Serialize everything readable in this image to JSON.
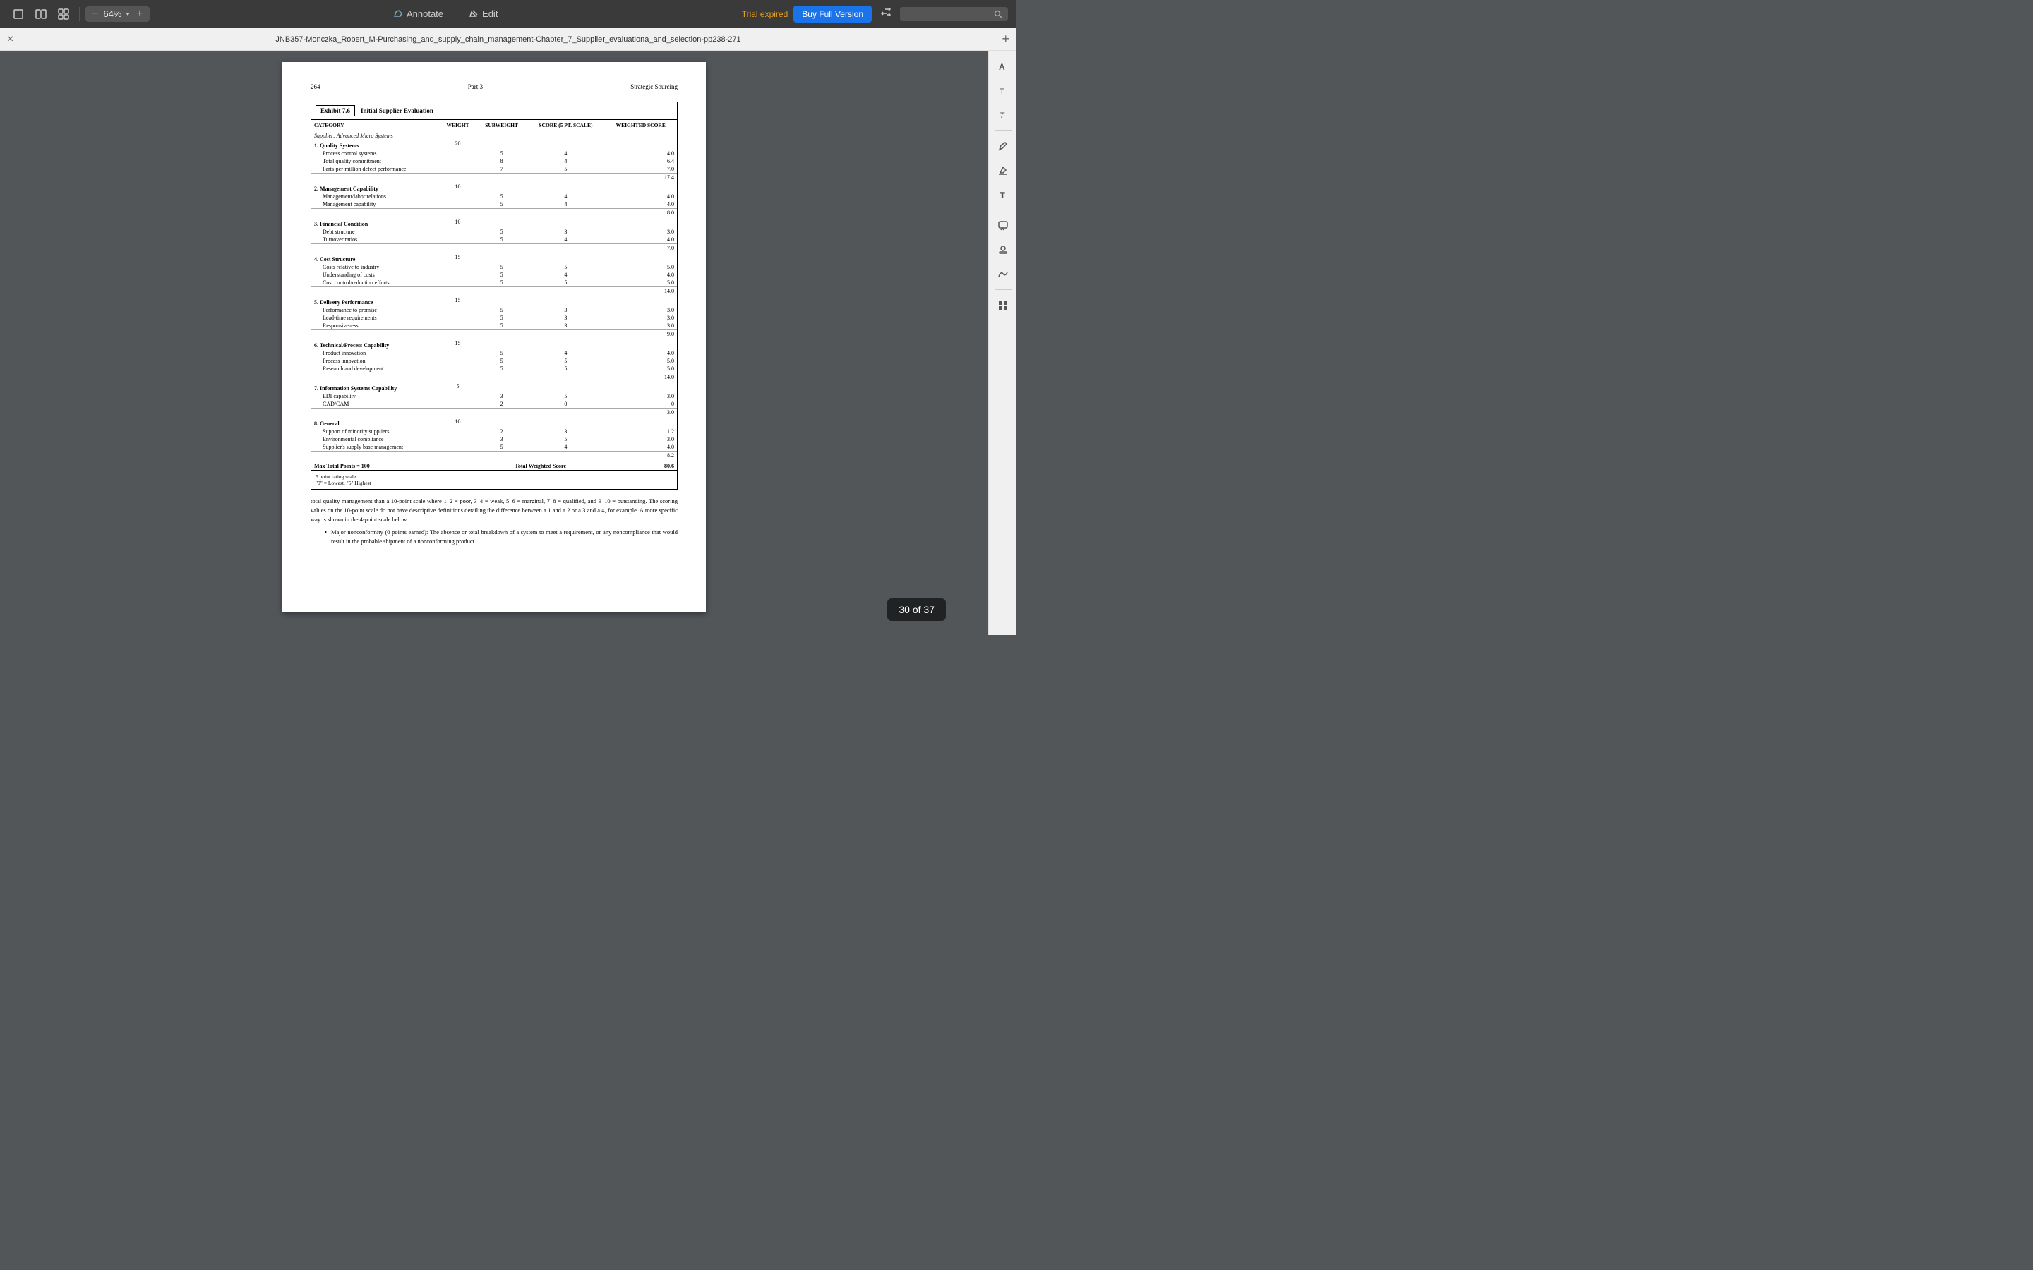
{
  "toolbar": {
    "zoom_value": "64%",
    "annotate_label": "Annotate",
    "edit_label": "Edit",
    "trial_label": "Trial expired",
    "buy_label": "Buy Full Version",
    "search_placeholder": ""
  },
  "titlebar": {
    "title": "JNB357-Monczka_Robert_M-Purchasing_and_supply_chain_management-Chapter_7_Supplier_evaluationa_and_selection-pp238-271",
    "close_icon": "×",
    "add_icon": "+"
  },
  "page": {
    "header_page": "264",
    "header_part": "Part 3",
    "header_title": "Strategic Sourcing",
    "exhibit_label": "Exhibit 7.6",
    "exhibit_title": "Initial Supplier Evaluation",
    "table": {
      "columns": [
        "CATEGORY",
        "WEIGHT",
        "SUBWEIGHT",
        "SCORE (5 PT. SCALE)",
        "WEIGHTED SCORE"
      ],
      "rows": [
        {
          "type": "supplier",
          "category": "Supplier: Advanced Micro Systems",
          "weight": "",
          "subweight": "",
          "score": "",
          "weighted": ""
        },
        {
          "type": "category",
          "category": "1. Quality Systems",
          "weight": "20",
          "subweight": "",
          "score": "",
          "weighted": ""
        },
        {
          "type": "sub",
          "category": "Process control systems",
          "weight": "",
          "subweight": "5",
          "score": "4",
          "weighted": "4.0"
        },
        {
          "type": "sub",
          "category": "Total quality commitment",
          "weight": "",
          "subweight": "8",
          "score": "4",
          "weighted": "6.4"
        },
        {
          "type": "sub",
          "category": "Parts-per-million defect performance",
          "weight": "",
          "subweight": "7",
          "score": "5",
          "weighted": "7.0"
        },
        {
          "type": "subtotal",
          "weighted": "17.4"
        },
        {
          "type": "category",
          "category": "2. Management Capability",
          "weight": "10",
          "subweight": "",
          "score": "",
          "weighted": ""
        },
        {
          "type": "sub",
          "category": "Management/labor relations",
          "weight": "",
          "subweight": "5",
          "score": "4",
          "weighted": "4.0"
        },
        {
          "type": "sub",
          "category": "Management capability",
          "weight": "",
          "subweight": "5",
          "score": "4",
          "weighted": "4.0"
        },
        {
          "type": "subtotal",
          "weighted": "8.0"
        },
        {
          "type": "category",
          "category": "3. Financial Condition",
          "weight": "10",
          "subweight": "",
          "score": "",
          "weighted": ""
        },
        {
          "type": "sub",
          "category": "Debt structure",
          "weight": "",
          "subweight": "5",
          "score": "3",
          "weighted": "3.0"
        },
        {
          "type": "sub",
          "category": "Turnover ratios",
          "weight": "",
          "subweight": "5",
          "score": "4",
          "weighted": "4.0"
        },
        {
          "type": "subtotal",
          "weighted": "7.0"
        },
        {
          "type": "category",
          "category": "4. Cost Structure",
          "weight": "15",
          "subweight": "",
          "score": "",
          "weighted": ""
        },
        {
          "type": "sub",
          "category": "Costs relative to industry",
          "weight": "",
          "subweight": "5",
          "score": "5",
          "weighted": "5.0"
        },
        {
          "type": "sub",
          "category": "Understanding of costs",
          "weight": "",
          "subweight": "5",
          "score": "4",
          "weighted": "4.0"
        },
        {
          "type": "sub",
          "category": "Cost control/reduction efforts",
          "weight": "",
          "subweight": "5",
          "score": "5",
          "weighted": "5.0"
        },
        {
          "type": "subtotal",
          "weighted": "14.0"
        },
        {
          "type": "category",
          "category": "5. Delivery Performance",
          "weight": "15",
          "subweight": "",
          "score": "",
          "weighted": ""
        },
        {
          "type": "sub",
          "category": "Performance to promise",
          "weight": "",
          "subweight": "5",
          "score": "3",
          "weighted": "3.0"
        },
        {
          "type": "sub",
          "category": "Lead-time requirements",
          "weight": "",
          "subweight": "5",
          "score": "3",
          "weighted": "3.0"
        },
        {
          "type": "sub",
          "category": "Responsiveness",
          "weight": "",
          "subweight": "5",
          "score": "3",
          "weighted": "3.0"
        },
        {
          "type": "subtotal",
          "weighted": "9.0"
        },
        {
          "type": "category",
          "category": "6. Technical/Process Capability",
          "weight": "15",
          "subweight": "",
          "score": "",
          "weighted": ""
        },
        {
          "type": "sub",
          "category": "Product innovation",
          "weight": "",
          "subweight": "5",
          "score": "4",
          "weighted": "4.0"
        },
        {
          "type": "sub",
          "category": "Process innovation",
          "weight": "",
          "subweight": "5",
          "score": "5",
          "weighted": "5.0"
        },
        {
          "type": "sub",
          "category": "Research and development",
          "weight": "",
          "subweight": "5",
          "score": "5",
          "weighted": "5.0"
        },
        {
          "type": "subtotal",
          "weighted": "14.0"
        },
        {
          "type": "category",
          "category": "7. Information Systems Capability",
          "weight": "5",
          "subweight": "",
          "score": "",
          "weighted": ""
        },
        {
          "type": "sub",
          "category": "EDI capability",
          "weight": "",
          "subweight": "3",
          "score": "5",
          "weighted": "3.0"
        },
        {
          "type": "sub",
          "category": "CAD/CAM",
          "weight": "",
          "subweight": "2",
          "score": "0",
          "weighted": "0"
        },
        {
          "type": "subtotal",
          "weighted": "3.0"
        },
        {
          "type": "category",
          "category": "8. General",
          "weight": "10",
          "subweight": "",
          "score": "",
          "weighted": ""
        },
        {
          "type": "sub",
          "category": "Support of minority suppliers",
          "weight": "",
          "subweight": "2",
          "score": "3",
          "weighted": "1.2"
        },
        {
          "type": "sub",
          "category": "Environmental compliance",
          "weight": "",
          "subweight": "3",
          "score": "5",
          "weighted": "3.0"
        },
        {
          "type": "sub",
          "category": "Supplier's supply base management",
          "weight": "",
          "subweight": "5",
          "score": "4",
          "weighted": "4.0"
        },
        {
          "type": "subtotal",
          "weighted": "8.2"
        }
      ],
      "footer_row": {
        "left": "Max Total Points = 100",
        "center": "Total Weighted Score",
        "right": "80.6"
      },
      "footnotes": [
        "5 point rating scale",
        "\"0\" = Lowest, \"5\" Highest"
      ]
    },
    "body_text": [
      "total quality management than a 10-point scale where 1–2 = poor, 3–4 = weak, 5–6 = marginal, 7–8 = qualified, and 9–10 = outstanding. The scoring values on the 10-point scale do not have descriptive definitions detailing the difference between a 1 and a 2 or a 3 and a 4, for example. A more specific way is shown in the 4-point scale below:",
      "• Major nonconformity (0 points earned): The absence or total breakdown of a system to meet a requirement, or any noncompliance that would result in the probable shipment of a nonconforming product."
    ]
  },
  "page_counter": {
    "label": "30 of 37"
  },
  "right_sidebar": {
    "icons": [
      {
        "name": "text-format-icon",
        "symbol": "A"
      },
      {
        "name": "font-icon",
        "symbol": "T"
      },
      {
        "name": "font-alt-icon",
        "symbol": "T"
      },
      {
        "name": "pen-icon",
        "symbol": "✏"
      },
      {
        "name": "highlight-icon",
        "symbol": "▐"
      },
      {
        "name": "text-icon",
        "symbol": "T"
      },
      {
        "name": "speech-bubble-icon",
        "symbol": "◯"
      },
      {
        "name": "marker-icon",
        "symbol": "✦"
      },
      {
        "name": "signature-icon",
        "symbol": "✒"
      },
      {
        "name": "grid-icon",
        "symbol": "⊞"
      }
    ]
  }
}
